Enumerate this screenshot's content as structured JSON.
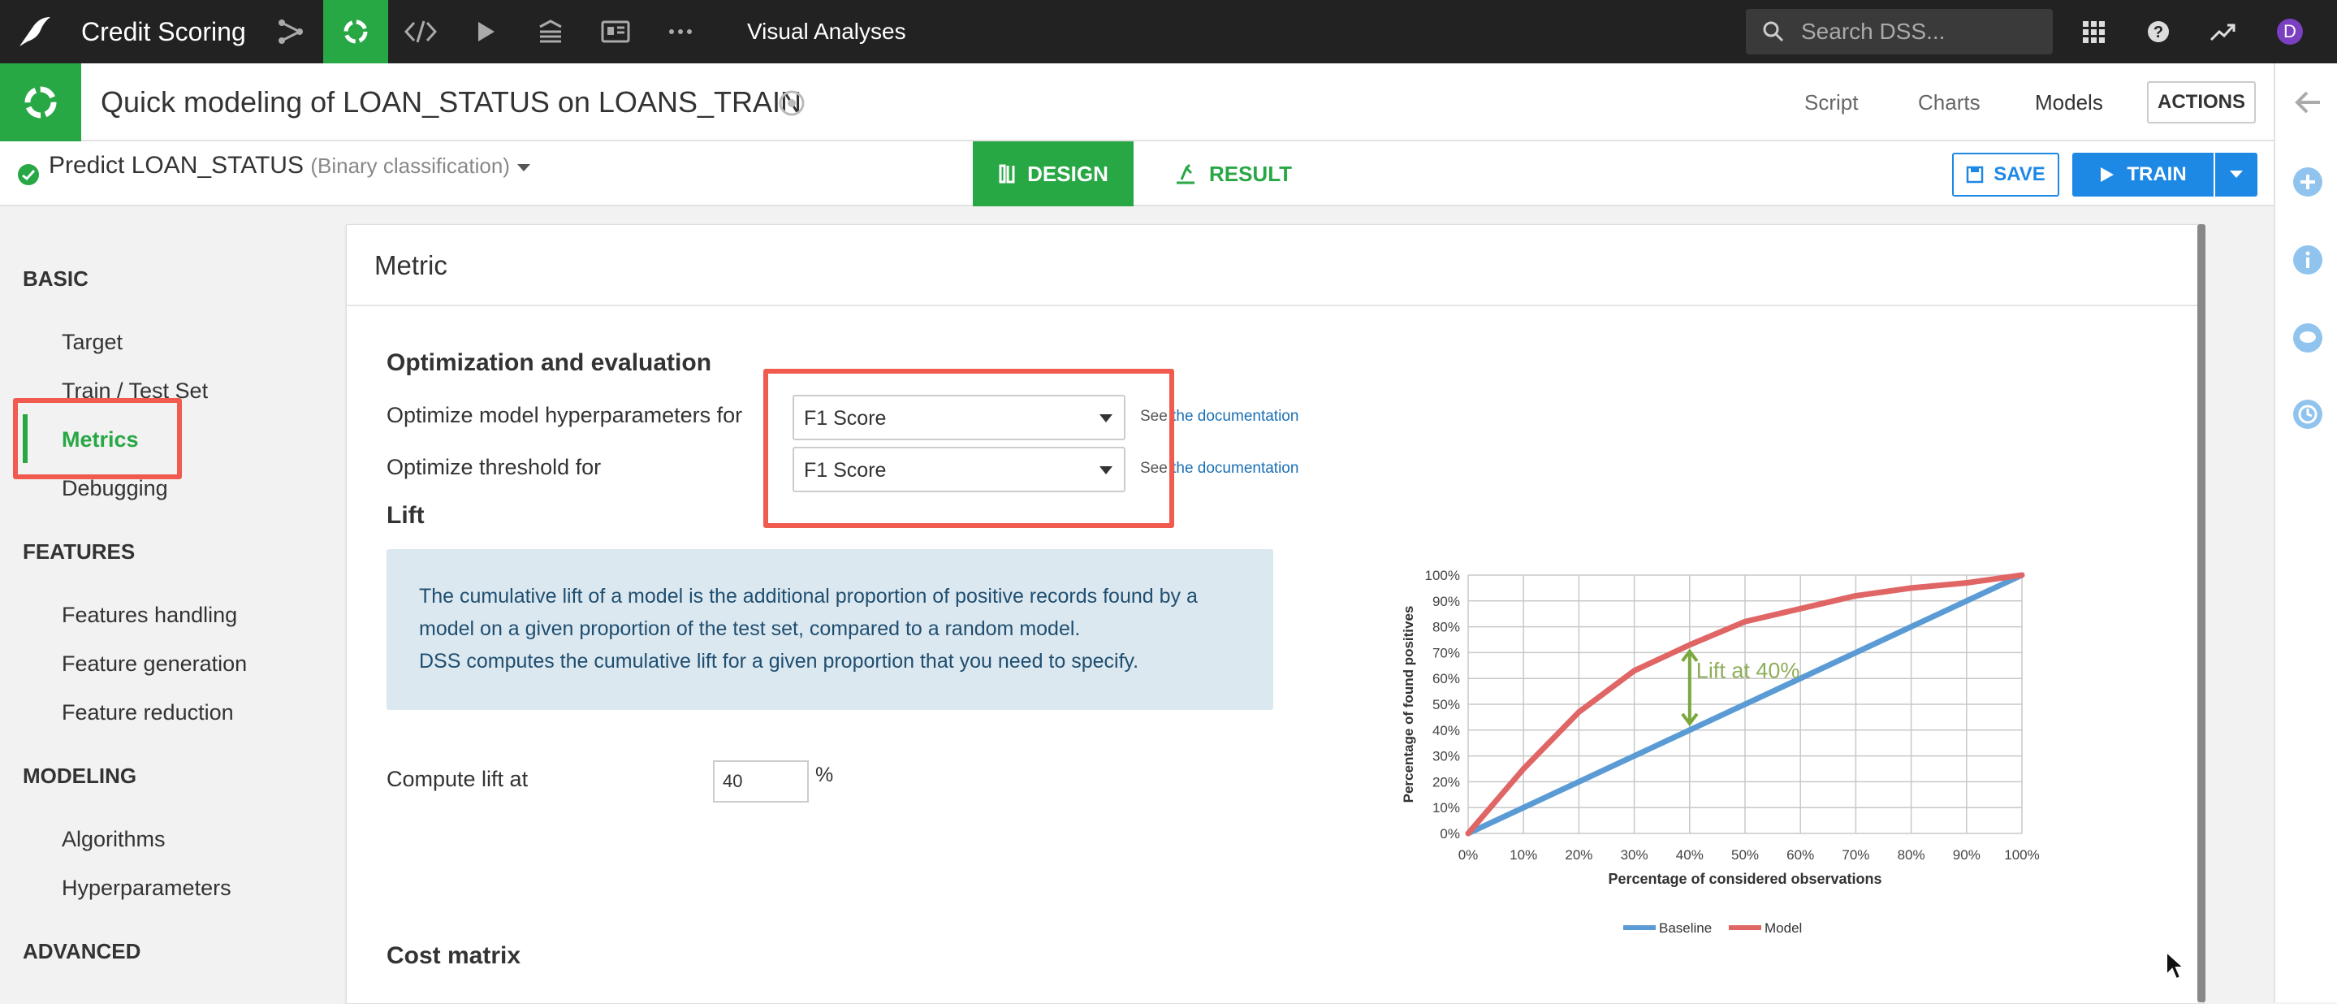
{
  "app": {
    "project_name": "Credit Scoring",
    "section_title": "Visual Analyses",
    "search_placeholder": "Search DSS...",
    "user_initial": "D"
  },
  "header": {
    "title": "Quick modeling of LOAN_STATUS on LOANS_TRAIN",
    "tabs": [
      "Script",
      "Charts",
      "Models"
    ],
    "active_tab": "Models",
    "actions_label": "ACTIONS"
  },
  "toolbar": {
    "prediction_label": "Predict LOAN_STATUS",
    "prediction_type": "(Binary classification)",
    "design_label": "DESIGN",
    "result_label": "RESULT",
    "save_label": "SAVE",
    "train_label": "TRAIN"
  },
  "sidebar": {
    "sections": [
      {
        "heading": "BASIC",
        "items": [
          "Target",
          "Train / Test Set",
          "Metrics",
          "Debugging"
        ]
      },
      {
        "heading": "FEATURES",
        "items": [
          "Features handling",
          "Feature generation",
          "Feature reduction"
        ]
      },
      {
        "heading": "MODELING",
        "items": [
          "Algorithms",
          "Hyperparameters"
        ]
      },
      {
        "heading": "ADVANCED",
        "items": []
      }
    ],
    "active_item": "Metrics"
  },
  "panel": {
    "title": "Metric",
    "optimization": {
      "heading": "Optimization and evaluation",
      "hyperparams_label": "Optimize model hyperparameters for",
      "hyperparams_value": "F1 Score",
      "threshold_label": "Optimize threshold for",
      "threshold_value": "F1 Score",
      "doc_prefix": "See",
      "doc_link": "the documentation"
    },
    "lift": {
      "heading": "Lift",
      "info_lines": [
        "The cumulative lift of a model is the additional proportion of positive records found by a",
        "model on a given proportion of the test set, compared to a random model.",
        "DSS computes the cumulative lift for a given proportion that you need to specify."
      ],
      "compute_label": "Compute lift at",
      "compute_value": "40",
      "unit": "%"
    },
    "cost_matrix_heading": "Cost matrix"
  },
  "colors": {
    "green": "#28a745",
    "blue": "#1e88e5",
    "highlight_red": "#f05a4f",
    "baseline": "#5b9bd5",
    "model": "#e06666"
  },
  "chart_data": {
    "type": "line",
    "x": [
      0,
      10,
      20,
      30,
      40,
      50,
      60,
      70,
      80,
      90,
      100
    ],
    "x_tick_labels": [
      "0%",
      "10%",
      "20%",
      "30%",
      "40%",
      "50%",
      "60%",
      "70%",
      "80%",
      "90%",
      "100%"
    ],
    "y_tick_labels": [
      "0%",
      "10%",
      "20%",
      "30%",
      "40%",
      "50%",
      "60%",
      "70%",
      "80%",
      "90%",
      "100%"
    ],
    "series": [
      {
        "name": "Baseline",
        "values": [
          0,
          10,
          20,
          30,
          40,
          50,
          60,
          70,
          80,
          90,
          100
        ]
      },
      {
        "name": "Model",
        "values": [
          0,
          25,
          47,
          63,
          73,
          82,
          87,
          92,
          95,
          97,
          100
        ]
      }
    ],
    "annotation": "Lift at 40%",
    "annotation_x": 40,
    "xlabel": "Percentage of considered observations",
    "ylabel": "Percentage of found positives",
    "xlim": [
      0,
      100
    ],
    "ylim": [
      0,
      100
    ],
    "grid": true,
    "legend": "bottom"
  }
}
